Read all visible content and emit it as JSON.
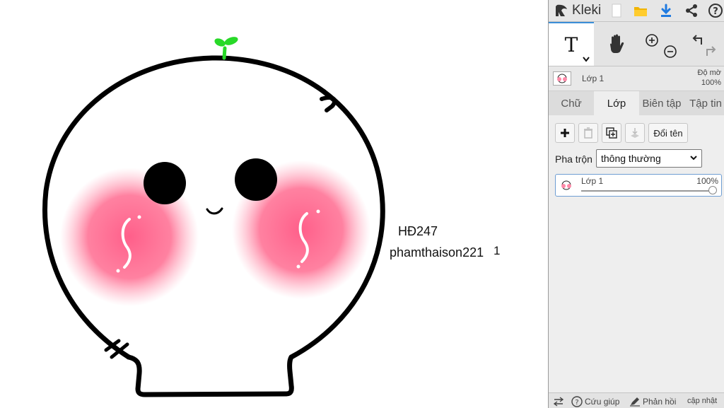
{
  "canvas": {
    "text_line1": "HĐ247",
    "text_line2": "phamthaison221",
    "text_mark": "1"
  },
  "app": {
    "title": "Kleki",
    "toolbar_icons": [
      "new-file-icon",
      "open-folder-icon",
      "download-icon",
      "share-icon",
      "help-icon"
    ],
    "accent_color": "#2f7fd1"
  },
  "tools": {
    "text_tool_glyph": "T",
    "items": [
      "text-tool",
      "hand-tool",
      "zoom-in",
      "zoom-out",
      "undo",
      "redo"
    ]
  },
  "current_layer": {
    "name": "Lớp 1",
    "opacity_label": "Độ mờ",
    "opacity_value": "100%"
  },
  "tabs": [
    {
      "label": "Chữ",
      "active": false
    },
    {
      "label": "Lớp",
      "active": true
    },
    {
      "label": "Biên tập",
      "active": false
    },
    {
      "label": "Tập tin",
      "active": false
    }
  ],
  "layers_panel": {
    "rename_label": "Đổi tên",
    "blend_label": "Pha trộn",
    "blend_value": "thông thường",
    "layers": [
      {
        "name": "Lớp 1",
        "opacity": "100%",
        "opacity_fraction": 1.0
      }
    ]
  },
  "footer": {
    "help_label": "Cứu giúp",
    "feedback_label": "Phản hồi",
    "update_label": "cập nhật"
  }
}
